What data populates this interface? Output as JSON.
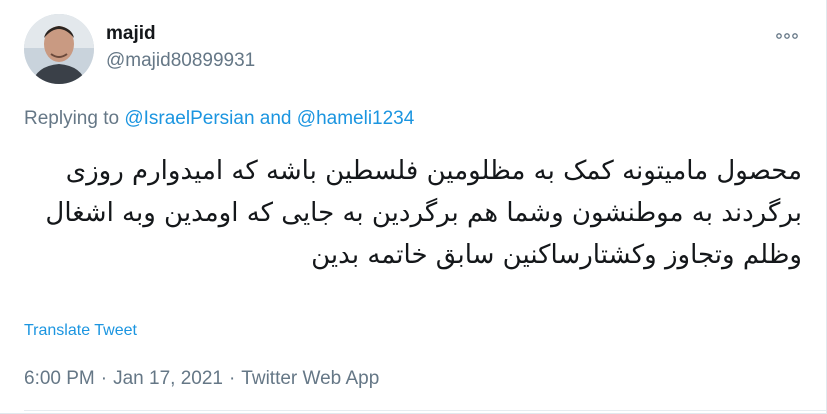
{
  "author": {
    "display_name": "majid",
    "handle": "@majid80899931",
    "avatar_icon": "user-avatar-photo"
  },
  "reply": {
    "prefix": "Replying to",
    "user1": "@IsraelPersian",
    "connector": "and",
    "user2": "@hameli1234"
  },
  "tweet": {
    "text": "محصول مامیتونه کمک به مظلومین فلسطین باشه که امیدوارم روزی برگردند به موطنشون وشما هم برگردین به جایی که اومدین وبه اشغال وظلم وتجاوز وکشتارساکنین سابق خاتمه بدین"
  },
  "actions": {
    "translate_label": "Translate Tweet",
    "more_icon": "more-dots-icon"
  },
  "meta": {
    "time": "6:00 PM",
    "separator": "·",
    "date": "Jan 17, 2021",
    "source": "Twitter Web App"
  },
  "colors": {
    "link": "#1b95e0",
    "muted": "#657786",
    "text": "#14171a"
  }
}
